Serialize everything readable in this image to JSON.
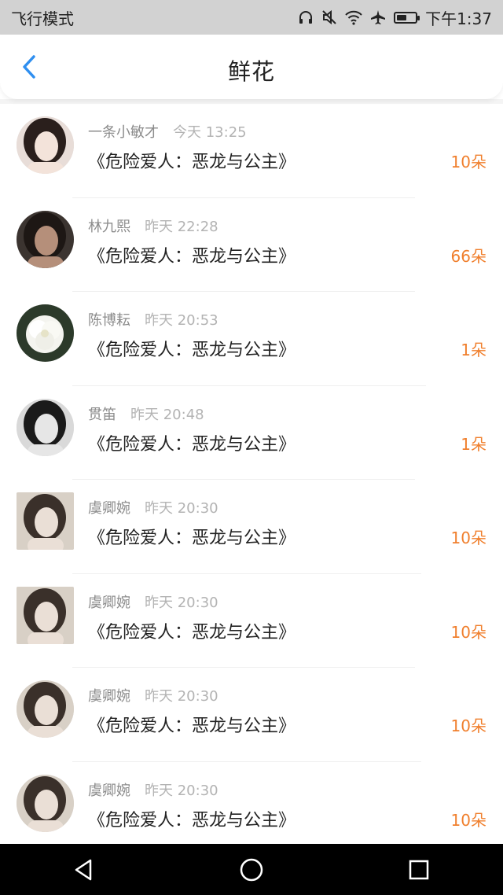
{
  "status_bar": {
    "mode": "飞行模式",
    "time": "下午1:37",
    "icons": [
      "headphones-icon",
      "mute-icon",
      "wifi-icon",
      "airplane-icon",
      "battery-icon"
    ],
    "battery_level": 0.55
  },
  "header": {
    "title": "鲜花",
    "back_icon": "chevron-left-icon",
    "accent_color": "#2f8ff0"
  },
  "colors": {
    "count": "#f07f2d",
    "meta": "#9a9a9a",
    "title_text": "#222222"
  },
  "records": [
    {
      "name": "一条小敏才",
      "time": "今天 13:25",
      "book": "《危险爱人：恶龙与公主》",
      "count": "10朵"
    },
    {
      "name": "林九熙",
      "time": "昨天 22:28",
      "book": "《危险爱人：恶龙与公主》",
      "count": "66朵"
    },
    {
      "name": "陈博耘",
      "time": "昨天 20:53",
      "book": "《危险爱人：恶龙与公主》",
      "count": "1朵"
    },
    {
      "name": "贯笛",
      "time": "昨天 20:48",
      "book": "《危险爱人：恶龙与公主》",
      "count": "1朵"
    },
    {
      "name": "虞卿婉",
      "time": "昨天 20:30",
      "book": "《危险爱人：恶龙与公主》",
      "count": "10朵"
    },
    {
      "name": "虞卿婉",
      "time": "昨天 20:30",
      "book": "《危险爱人：恶龙与公主》",
      "count": "10朵"
    },
    {
      "name": "虞卿婉",
      "time": "昨天 20:30",
      "book": "《危险爱人：恶龙与公主》",
      "count": "10朵"
    },
    {
      "name": "虞卿婉",
      "time": "昨天 20:30",
      "book": "《危险爱人：恶龙与公主》",
      "count": "10朵"
    }
  ],
  "nav_bar": {
    "buttons": [
      "back-triangle-icon",
      "home-circle-icon",
      "recents-square-icon"
    ]
  }
}
